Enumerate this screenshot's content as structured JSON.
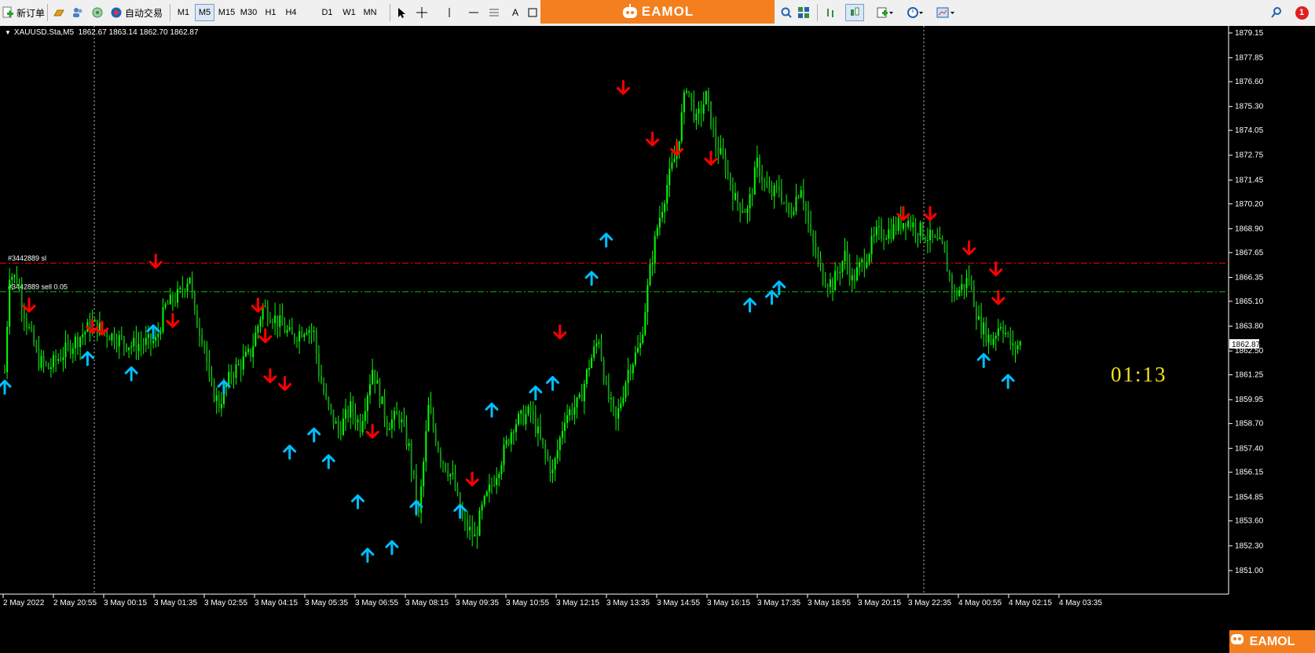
{
  "toolbar": {
    "new_order": "新订单",
    "auto_trading": "自动交易",
    "timeframes": [
      "M1",
      "M5",
      "M15",
      "M30",
      "H1",
      "H4",
      "D1",
      "W1",
      "MN"
    ],
    "active_timeframe": "M5",
    "text_tool": "A",
    "badge_count": "1"
  },
  "brand": {
    "name": "EAMOL",
    "color": "#f37f1e"
  },
  "chart": {
    "symbol_header": "XAUUSD.Sta,M5  1862.67 1863.14 1862.70 1862.87",
    "background": "#000000",
    "candle_color": "#00ff00",
    "sell_signal_color": "#ff0000",
    "buy_signal_color": "#00bfff",
    "timer": "01:13",
    "timer_color": "#f6e21d",
    "current_price": "1862.87",
    "price_axis": [
      "1879.15",
      "1877.85",
      "1876.60",
      "1875.30",
      "1874.05",
      "1872.75",
      "1871.45",
      "1870.20",
      "1868.90",
      "1867.65",
      "1866.35",
      "1865.10",
      "1863.80",
      "1862.50",
      "1861.25",
      "1859.95",
      "1858.70",
      "1857.40",
      "1856.15",
      "1854.85",
      "1853.60",
      "1852.30",
      "1851.00"
    ],
    "time_axis": [
      "2 May 2022",
      "2 May 20:55",
      "3 May 00:15",
      "3 May 01:35",
      "3 May 02:55",
      "3 May 04:15",
      "3 May 05:35",
      "3 May 06:55",
      "3 May 08:15",
      "3 May 09:35",
      "3 May 10:55",
      "3 May 12:15",
      "3 May 13:35",
      "3 May 14:55",
      "3 May 16:15",
      "3 May 17:35",
      "3 May 18:55",
      "3 May 20:15",
      "3 May 22:35",
      "4 May 00:55",
      "4 May 02:15",
      "4 May 03:35"
    ],
    "levels": [
      {
        "label": "#3442889 sl",
        "price": 1867.1,
        "color": "#ff0000"
      },
      {
        "label": "#3442889 sell 0.05",
        "price": 1865.6,
        "color": "#00c000"
      }
    ]
  },
  "chart_data": {
    "type": "candlestick",
    "price_range": [
      1850.2,
      1879.9
    ],
    "close_path": [
      [
        0,
        1861.4
      ],
      [
        2,
        1866.6
      ],
      [
        5,
        1866.2
      ],
      [
        9,
        1864.0
      ],
      [
        14,
        1862.0
      ],
      [
        18,
        1861.6
      ],
      [
        28,
        1862.9
      ],
      [
        36,
        1863.9
      ],
      [
        44,
        1863.3
      ],
      [
        52,
        1862.8
      ],
      [
        62,
        1863.0
      ],
      [
        66,
        1864.8
      ],
      [
        72,
        1865.5
      ],
      [
        76,
        1866.5
      ],
      [
        78,
        1864.3
      ],
      [
        82,
        1863.0
      ],
      [
        84,
        1860.8
      ],
      [
        88,
        1859.7
      ],
      [
        93,
        1861.3
      ],
      [
        101,
        1862.4
      ],
      [
        106,
        1864.8
      ],
      [
        111,
        1864.2
      ],
      [
        118,
        1863.2
      ],
      [
        124,
        1863.8
      ],
      [
        127,
        1863.4
      ],
      [
        129,
        1861.4
      ],
      [
        132,
        1859.8
      ],
      [
        137,
        1858.3
      ],
      [
        142,
        1859.5
      ],
      [
        146,
        1858.6
      ],
      [
        151,
        1861.6
      ],
      [
        157,
        1858.7
      ],
      [
        162,
        1859.1
      ],
      [
        166,
        1857.4
      ],
      [
        170,
        1853.8
      ],
      [
        174,
        1859.5
      ],
      [
        179,
        1857.0
      ],
      [
        184,
        1855.8
      ],
      [
        188,
        1853.6
      ],
      [
        193,
        1852.7
      ],
      [
        196,
        1854.2
      ],
      [
        203,
        1856.5
      ],
      [
        209,
        1858.7
      ],
      [
        216,
        1859.3
      ],
      [
        221,
        1857.4
      ],
      [
        225,
        1856.1
      ],
      [
        230,
        1859.1
      ],
      [
        236,
        1859.8
      ],
      [
        240,
        1861.8
      ],
      [
        244,
        1863.2
      ],
      [
        247,
        1860.4
      ],
      [
        251,
        1858.8
      ],
      [
        256,
        1861.5
      ],
      [
        261,
        1862.8
      ],
      [
        265,
        1866.7
      ],
      [
        268,
        1869.0
      ],
      [
        272,
        1871.2
      ],
      [
        276,
        1873.0
      ],
      [
        280,
        1876.5
      ],
      [
        284,
        1874.5
      ],
      [
        288,
        1875.8
      ],
      [
        292,
        1873.3
      ],
      [
        296,
        1872.2
      ],
      [
        300,
        1870.4
      ],
      [
        305,
        1869.8
      ],
      [
        309,
        1872.3
      ],
      [
        314,
        1870.6
      ],
      [
        318,
        1871.0
      ],
      [
        322,
        1869.6
      ],
      [
        327,
        1871.2
      ],
      [
        331,
        1868.4
      ],
      [
        336,
        1866.4
      ],
      [
        340,
        1866.0
      ],
      [
        345,
        1867.5
      ],
      [
        348,
        1866.2
      ],
      [
        353,
        1867.3
      ],
      [
        358,
        1868.6
      ],
      [
        364,
        1868.8
      ],
      [
        370,
        1869.4
      ],
      [
        378,
        1868.6
      ],
      [
        385,
        1867.9
      ],
      [
        390,
        1865.4
      ],
      [
        396,
        1866.3
      ],
      [
        400,
        1864.0
      ],
      [
        405,
        1863.0
      ],
      [
        409,
        1864.0
      ],
      [
        414,
        1862.6
      ],
      [
        417,
        1862.9
      ]
    ],
    "sell_arrows": [
      [
        10,
        1864.9
      ],
      [
        36,
        1863.8
      ],
      [
        40,
        1863.7
      ],
      [
        62,
        1867.2
      ],
      [
        69,
        1864.1
      ],
      [
        104,
        1864.9
      ],
      [
        107,
        1863.3
      ],
      [
        109,
        1861.2
      ],
      [
        115,
        1860.8
      ],
      [
        151,
        1858.3
      ],
      [
        192,
        1855.8
      ],
      [
        228,
        1863.5
      ],
      [
        254,
        1876.3
      ],
      [
        266,
        1873.6
      ],
      [
        276,
        1873.1
      ],
      [
        290,
        1872.6
      ],
      [
        369,
        1869.7
      ],
      [
        380,
        1869.7
      ],
      [
        396,
        1867.9
      ],
      [
        407,
        1866.8
      ],
      [
        408,
        1865.3
      ]
    ],
    "buy_arrows": [
      [
        0,
        1860.6
      ],
      [
        34,
        1862.1
      ],
      [
        52,
        1861.3
      ],
      [
        61,
        1863.5
      ],
      [
        90,
        1860.6
      ],
      [
        117,
        1857.2
      ],
      [
        127,
        1858.1
      ],
      [
        133,
        1856.7
      ],
      [
        145,
        1854.6
      ],
      [
        149,
        1851.8
      ],
      [
        159,
        1852.2
      ],
      [
        169,
        1854.3
      ],
      [
        187,
        1854.1
      ],
      [
        200,
        1859.4
      ],
      [
        218,
        1860.3
      ],
      [
        225,
        1860.8
      ],
      [
        241,
        1866.3
      ],
      [
        247,
        1868.3
      ],
      [
        306,
        1864.9
      ],
      [
        315,
        1865.3
      ],
      [
        318,
        1865.8
      ],
      [
        402,
        1862.0
      ],
      [
        412,
        1860.9
      ]
    ]
  }
}
